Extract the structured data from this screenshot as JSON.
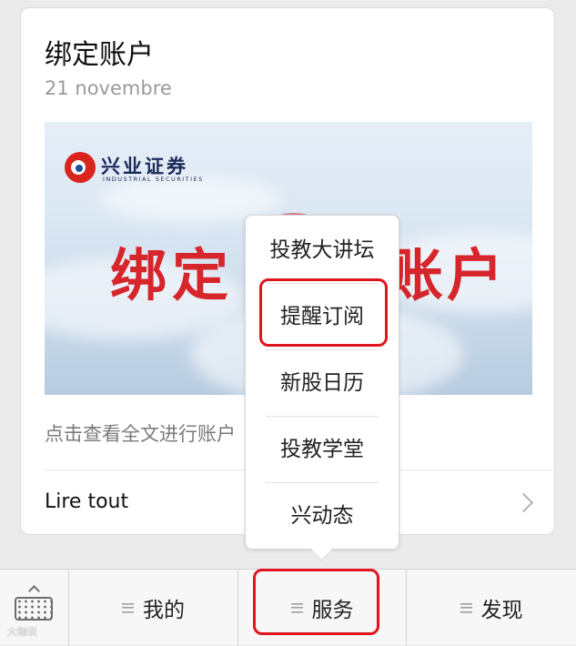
{
  "article": {
    "title": "绑定账户",
    "date": "21 novembre",
    "summary": "点击查看全文进行账户",
    "read_all": "Lire tout"
  },
  "banner": {
    "logo_text": "兴业证券",
    "logo_sub": "INDUSTRIAL SECURITIES",
    "headline_left": "绑定",
    "headline_right": "账户"
  },
  "popup_menu": {
    "items": [
      "投教大讲坛",
      "提醒订阅",
      "新股日历",
      "投教学堂",
      "兴动态"
    ],
    "highlighted": "提醒订阅"
  },
  "bottom_bar": {
    "tabs": [
      "我的",
      "服务",
      "发现"
    ],
    "highlighted": "服务",
    "keyboard_icon": "keyboard-icon"
  },
  "watermark": "大咖说",
  "colors": {
    "highlight": "#e0141e",
    "brand_red": "#d6262b",
    "background": "#ebebeb"
  }
}
